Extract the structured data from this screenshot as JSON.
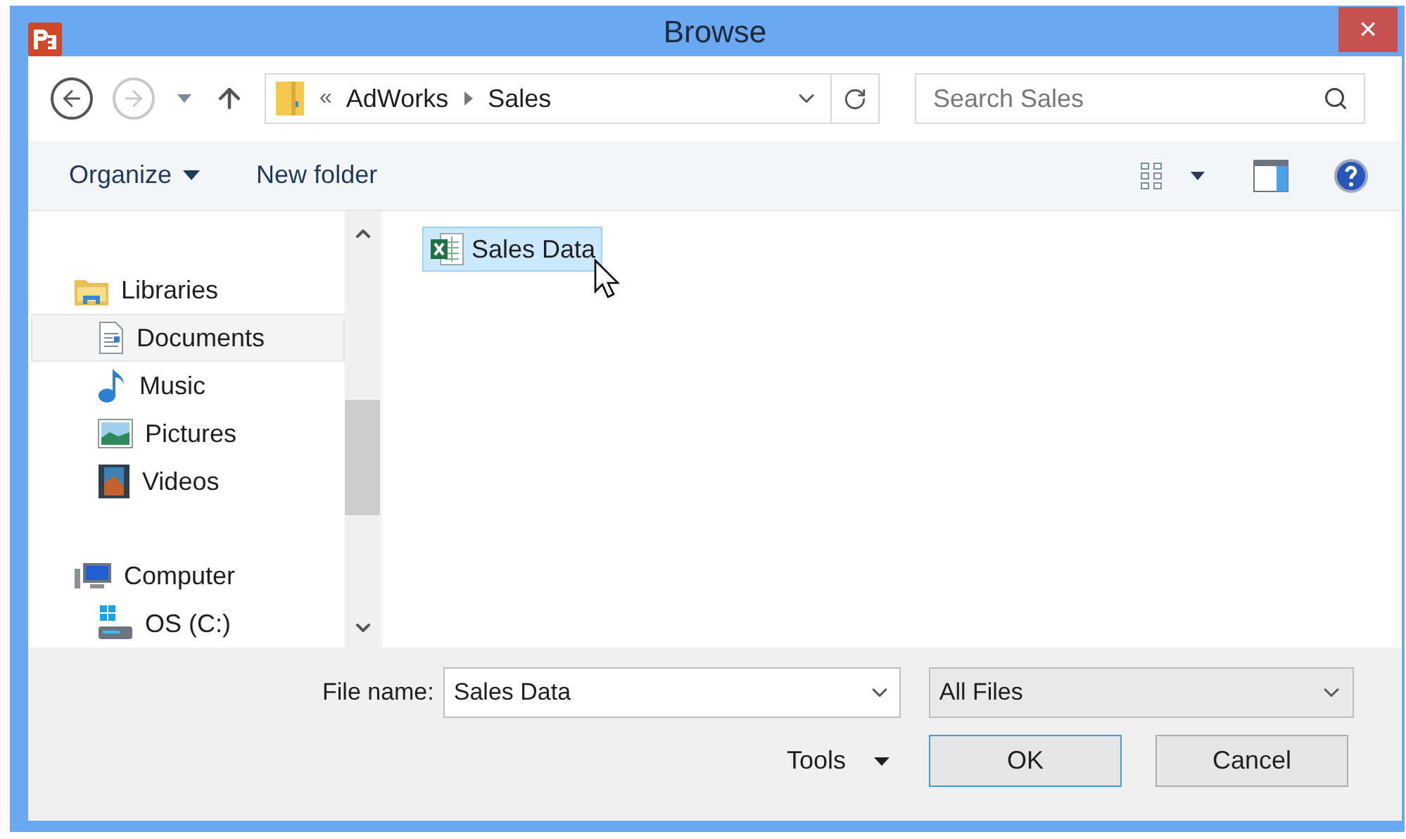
{
  "window": {
    "title": "Browse",
    "close": "×"
  },
  "address": {
    "overflow": "«",
    "crumbs": [
      "AdWorks",
      "Sales"
    ]
  },
  "search": {
    "placeholder": "Search Sales"
  },
  "commands": [
    "Organize",
    "New folder"
  ],
  "nav": [
    {
      "label": "Libraries",
      "selected": false,
      "children": [
        {
          "label": "Documents",
          "selected": true
        },
        {
          "label": "Music",
          "selected": false
        },
        {
          "label": "Pictures",
          "selected": false
        },
        {
          "label": "Videos",
          "selected": false
        }
      ]
    },
    {
      "label": "Computer",
      "selected": false,
      "children": [
        {
          "label": "OS (C:)",
          "selected": false
        }
      ]
    }
  ],
  "files": [
    {
      "name": "Sales Data",
      "selected": true
    }
  ],
  "file_name": {
    "label": "File name:",
    "value": "Sales Data"
  },
  "file_type": "All Files",
  "tools": "Tools",
  "buttons": [
    {
      "label": "OK",
      "kind": "default"
    },
    {
      "label": "Cancel",
      "kind": "normal"
    }
  ]
}
